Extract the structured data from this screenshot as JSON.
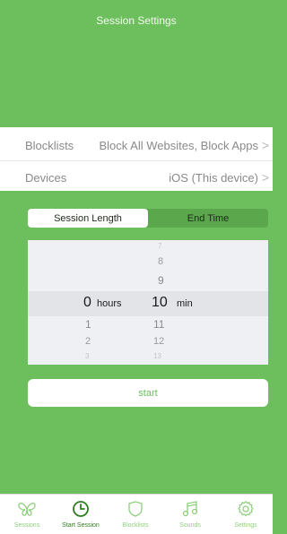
{
  "header": {
    "title": "Session Settings"
  },
  "list": {
    "blocklists": {
      "label": "Blocklists",
      "value": "Block All Websites, Block Apps",
      "chevron": ">"
    },
    "devices": {
      "label": "Devices",
      "value": "iOS (This device)",
      "chevron": ">"
    }
  },
  "segmented": {
    "left_label": "Session Length",
    "right_label": "End Time",
    "selected": "Session Length"
  },
  "picker": {
    "hours_label": "hours",
    "min_label": "min",
    "hours_values": [
      "0",
      "1",
      "2",
      "3"
    ],
    "min_values": [
      "7",
      "8",
      "9",
      "10",
      "11",
      "12",
      "13"
    ],
    "selected_hours": "0",
    "selected_min": "10"
  },
  "start": {
    "label": "start"
  },
  "tabbar": {
    "items": [
      {
        "label": "Sessions",
        "icon": "butterfly-icon"
      },
      {
        "label": "Start Session",
        "icon": "clock-icon"
      },
      {
        "label": "Blocklists",
        "icon": "shield-icon"
      },
      {
        "label": "Sounds",
        "icon": "music-note-icon"
      },
      {
        "label": "Settings",
        "icon": "gear-icon"
      }
    ],
    "active": "Start Session"
  },
  "colors": {
    "brand_green": "#6cbf5c",
    "dark_green": "#2f7d21",
    "light_green": "#8fcf7e"
  }
}
